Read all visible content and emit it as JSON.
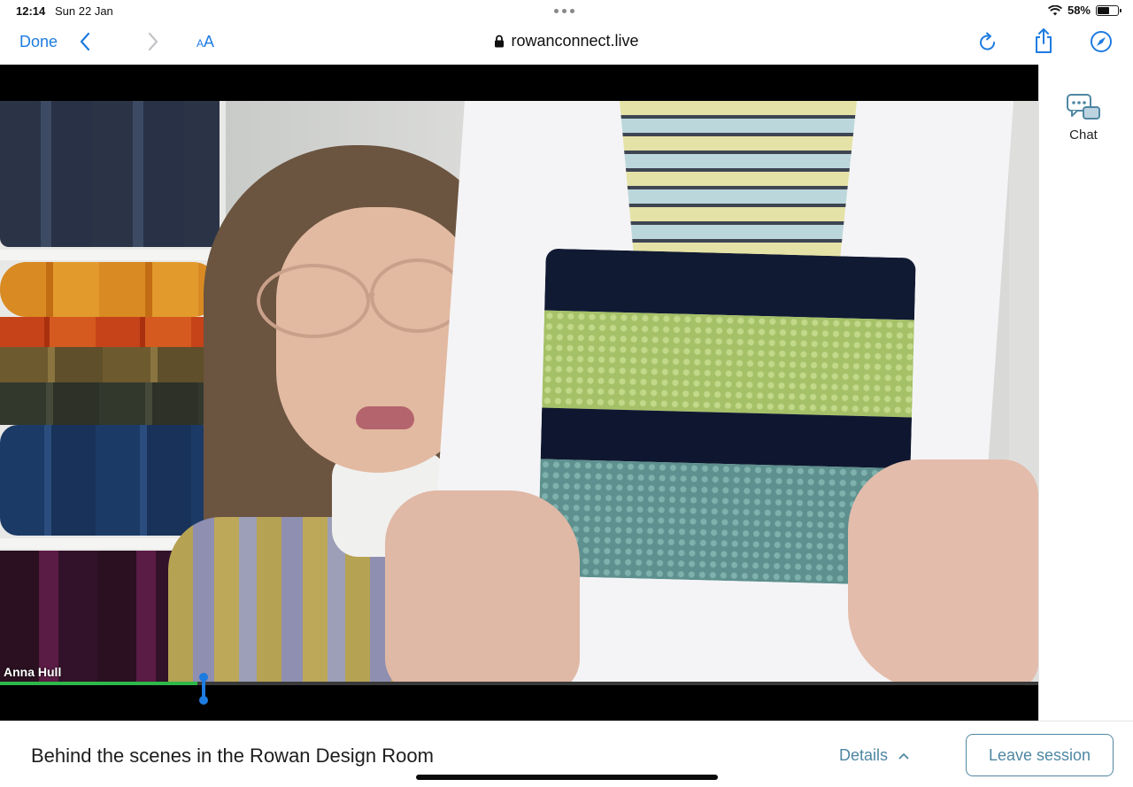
{
  "status_bar": {
    "time": "12:14",
    "date": "Sun 22 Jan",
    "battery_percent": "58%",
    "battery_level": 0.58
  },
  "browser": {
    "done_label": "Done",
    "text_size_small": "A",
    "text_size_large": "A",
    "url": "rowanconnect.live",
    "icons": [
      "back-chevron-icon",
      "forward-chevron-icon",
      "lock-icon",
      "reload-icon",
      "share-icon",
      "compass-icon"
    ]
  },
  "video": {
    "presenter_name": "Anna Hull",
    "progress": 0.19
  },
  "sidebar": {
    "chat_label": "Chat"
  },
  "session": {
    "title": "Behind the scenes in the Rowan Design Room",
    "details_label": "Details",
    "leave_label": "Leave session"
  },
  "colors": {
    "accent_blue": "#1e7be0",
    "session_teal": "#4f87a2",
    "progress_green": "#2db84a"
  }
}
